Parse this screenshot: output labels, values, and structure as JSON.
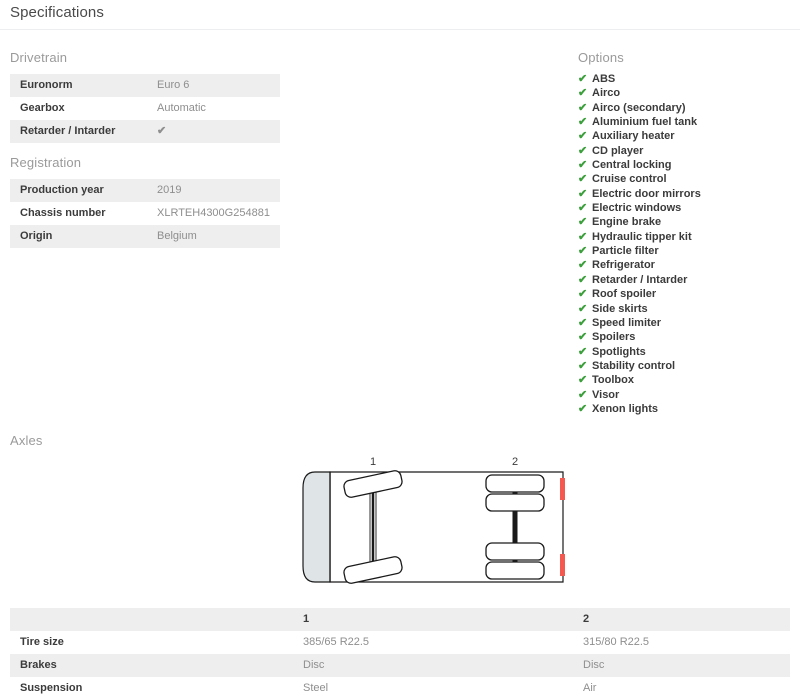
{
  "header": {
    "title": "Specifications"
  },
  "drivetrain": {
    "title": "Drivetrain",
    "rows": [
      {
        "label": "Euronorm",
        "value": "Euro 6",
        "is_check": false
      },
      {
        "label": "Gearbox",
        "value": "Automatic",
        "is_check": false
      },
      {
        "label": "Retarder / Intarder",
        "value": "✔",
        "is_check": true
      }
    ]
  },
  "registration": {
    "title": "Registration",
    "rows": [
      {
        "label": "Production year",
        "value": "2019"
      },
      {
        "label": "Chassis number",
        "value": "XLRTEH4300G254881"
      },
      {
        "label": "Origin",
        "value": "Belgium"
      }
    ]
  },
  "options": {
    "title": "Options",
    "check_glyph": "✔",
    "items": [
      "ABS",
      "Airco",
      "Airco (secondary)",
      "Aluminium fuel tank",
      "Auxiliary heater",
      "CD player",
      "Central locking",
      "Cruise control",
      "Electric door mirrors",
      "Electric windows",
      "Engine brake",
      "Hydraulic tipper kit",
      "Particle filter",
      "Refrigerator",
      "Retarder / Intarder",
      "Roof spoiler",
      "Side skirts",
      "Speed limiter",
      "Spoilers",
      "Spotlights",
      "Stability control",
      "Toolbox",
      "Visor",
      "Xenon lights"
    ]
  },
  "axles": {
    "title": "Axles",
    "diagram": {
      "axle_1_label": "1",
      "axle_2_label": "2"
    },
    "table": {
      "headers": [
        "",
        "1",
        "2"
      ],
      "rows": [
        {
          "label": "Tire size",
          "axle1": "385/65 R22.5",
          "axle2": "315/80 R22.5"
        },
        {
          "label": "Brakes",
          "axle1": "Disc",
          "axle2": "Disc"
        },
        {
          "label": "Suspension",
          "axle1": "Steel",
          "axle2": "Air"
        }
      ]
    }
  },
  "colors": {
    "check_green": "#3b9f3b",
    "row_stripe": "#eeeeee",
    "marker_red": "#f4584f",
    "text_dark": "#3b3b3b",
    "text_muted": "#8e8e8e",
    "title_muted": "#9a9a9a"
  }
}
